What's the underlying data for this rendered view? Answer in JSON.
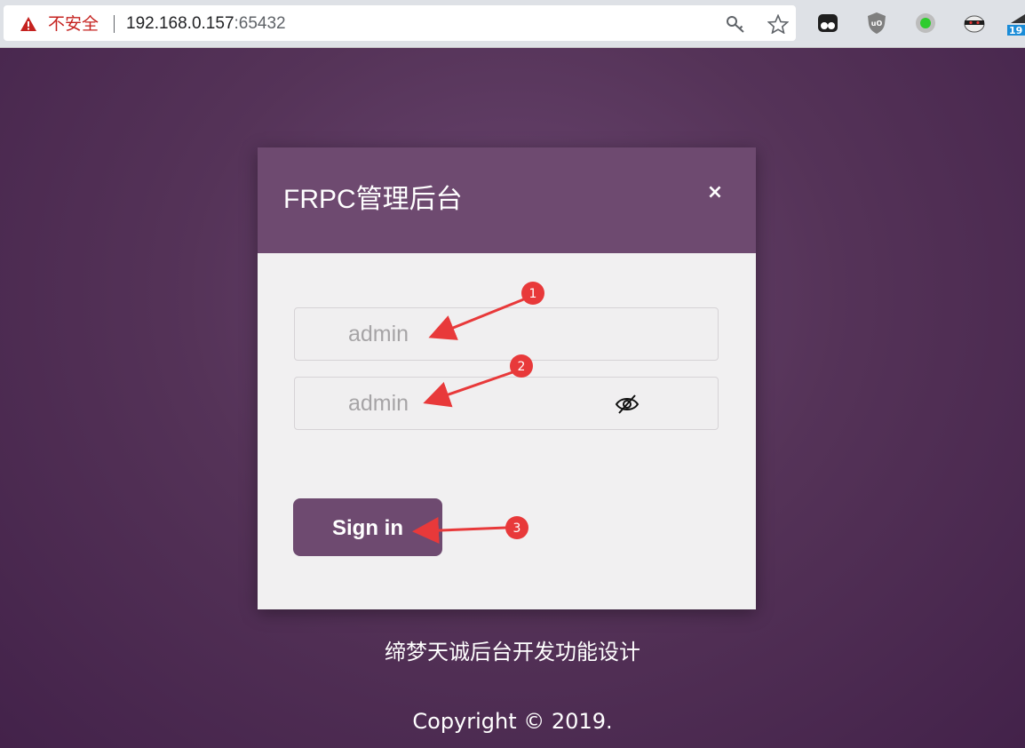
{
  "browser": {
    "insecure_label": "不安全",
    "url_host": "192.168.0.157",
    "url_port": ":65432",
    "icons": [
      "warning-icon",
      "key-icon",
      "star-icon",
      "tampermonkey-icon",
      "ublock-icon",
      "green-dot-icon",
      "ninja-icon",
      "partial-ext-icon"
    ],
    "partial_ext_text": "19"
  },
  "modal": {
    "title": "FRPC管理后台",
    "close_label": "×",
    "username_placeholder": "admin",
    "password_placeholder": "admin",
    "signin_label": "Sign in"
  },
  "footer": {
    "slogan": "缔梦天诚后台开发功能设计",
    "copyright": "Copyright © 2019."
  },
  "annotations": {
    "markers": [
      "1",
      "2",
      "3"
    ]
  },
  "colors": {
    "accent": "#6e4a70",
    "marker": "#e8393a",
    "insecure": "#c5221f"
  }
}
